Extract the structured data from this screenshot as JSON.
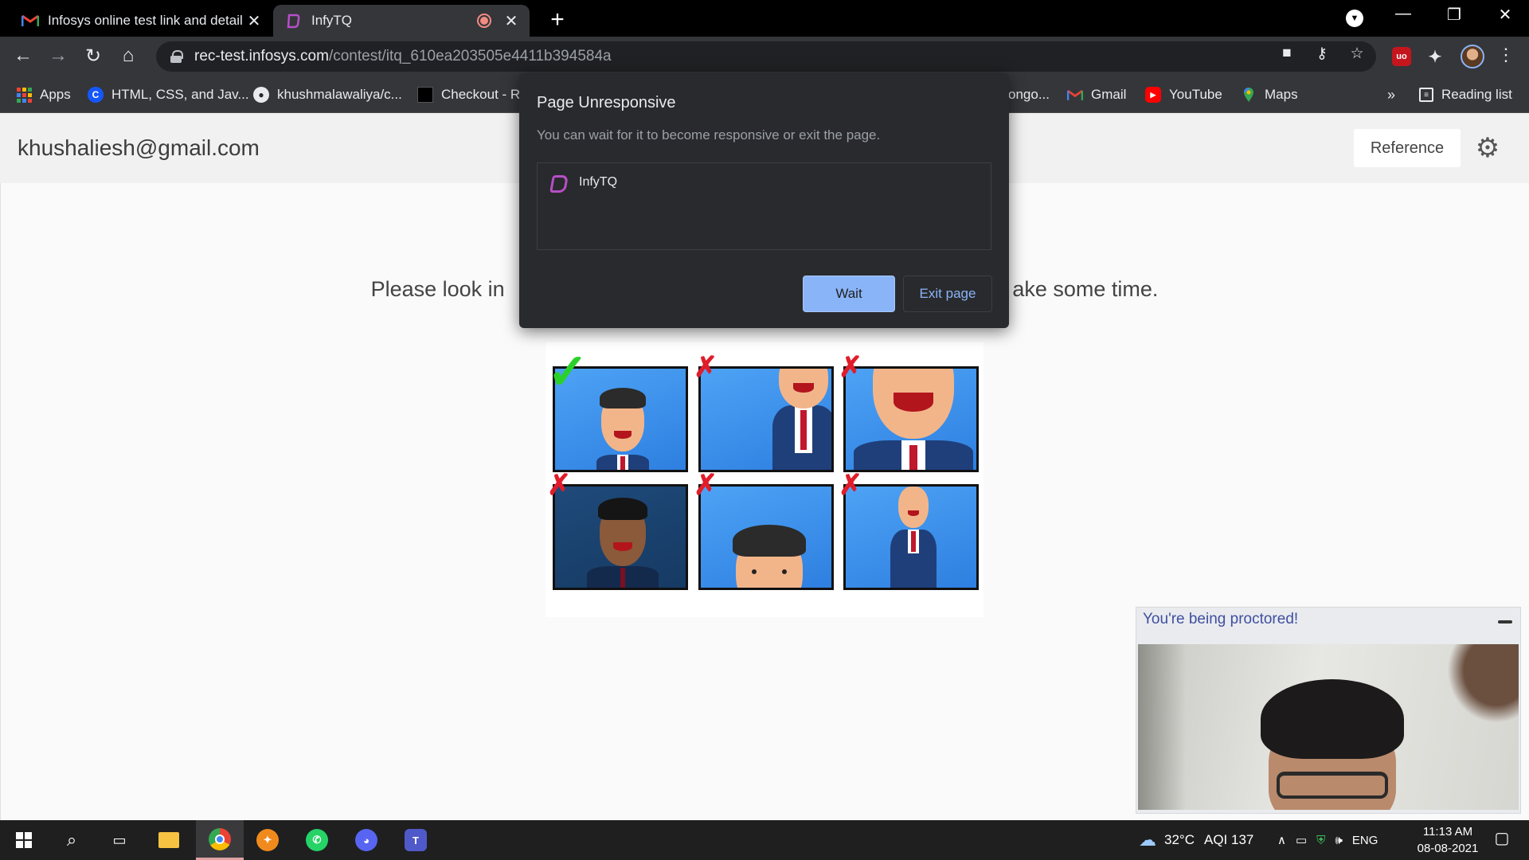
{
  "browser": {
    "tabs": [
      {
        "title": "Infosys online test link and detail",
        "icon": "gmail-icon",
        "close": "✕"
      },
      {
        "title": "InfyTQ",
        "icon": "infytq-icon",
        "close": "✕"
      }
    ],
    "new_tab": "+",
    "window_controls": {
      "minimize": "—",
      "restore": "❐",
      "close": "✕"
    },
    "url_host": "rec-test.infosys.com",
    "url_path": "/contest/itq_610ea203505e4411b394584a",
    "bookmarks": [
      {
        "label": "Apps",
        "icon": "apps-grid-icon"
      },
      {
        "label": "HTML, CSS, and Jav...",
        "icon": "codecademy-icon"
      },
      {
        "label": "khushmalawaliya/c...",
        "icon": "github-icon"
      },
      {
        "label": "Checkout - R",
        "icon": "page-icon"
      },
      {
        "label": "ongo...",
        "icon": "page-icon"
      },
      {
        "label": "Gmail",
        "icon": "gmail-icon"
      },
      {
        "label": "YouTube",
        "icon": "youtube-icon"
      },
      {
        "label": "Maps",
        "icon": "maps-icon"
      }
    ],
    "bookmarks_overflow": "»",
    "reading_list": "Reading list"
  },
  "page": {
    "user_email": "khushaliesh@gmail.com",
    "reference_label": "Reference",
    "instruction": "Please look in                                                                                     ake some time."
  },
  "dialog": {
    "title": "Page Unresponsive",
    "message": "You can wait for it to become responsive or exit the page.",
    "item": "InfyTQ",
    "wait_label": "Wait",
    "exit_label": "Exit page"
  },
  "proctor": {
    "title": "You're being proctored!"
  },
  "taskbar": {
    "weather": "32°C",
    "aqi": "AQI 137",
    "language": "ENG",
    "time": "11:13 AM",
    "date": "08-08-2021"
  },
  "colors": {
    "chrome_dark": "#35363a",
    "accent_blue": "#8ab4f8",
    "proctor_title": "#3f4fa0"
  }
}
